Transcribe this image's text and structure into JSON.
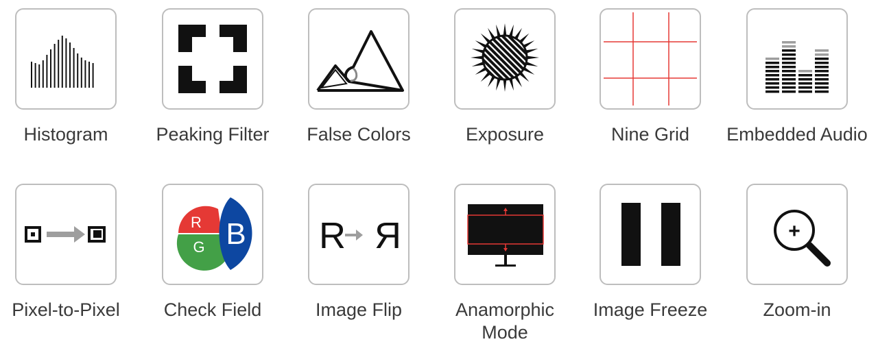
{
  "features": [
    {
      "label": "Histogram",
      "icon": "histogram-icon"
    },
    {
      "label": "Peaking Filter",
      "icon": "peaking-filter-icon"
    },
    {
      "label": "False Colors",
      "icon": "false-colors-icon"
    },
    {
      "label": "Exposure",
      "icon": "exposure-icon"
    },
    {
      "label": "Nine Grid",
      "icon": "nine-grid-icon"
    },
    {
      "label": "Embedded Audio",
      "icon": "embedded-audio-icon"
    },
    {
      "label": "Pixel-to-Pixel",
      "icon": "pixel-to-pixel-icon"
    },
    {
      "label": "Check Field",
      "icon": "check-field-icon",
      "letters": {
        "r": "R",
        "g": "G",
        "b": "B"
      }
    },
    {
      "label": "Image Flip",
      "icon": "image-flip-icon",
      "letters": {
        "left": "R",
        "right": "R"
      }
    },
    {
      "label": "Anamorphic\nMode",
      "icon": "anamorphic-mode-icon"
    },
    {
      "label": "Image Freeze",
      "icon": "image-freeze-icon"
    },
    {
      "label": "Zoom-in",
      "icon": "zoom-in-icon",
      "symbol": "+"
    }
  ],
  "colors": {
    "border": "#bdbdbd",
    "text": "#3a3a3a",
    "grid_red": "#e53935",
    "rgb_red": "#e53935",
    "rgb_green": "#43a047",
    "rgb_blue": "#0d47a1"
  }
}
